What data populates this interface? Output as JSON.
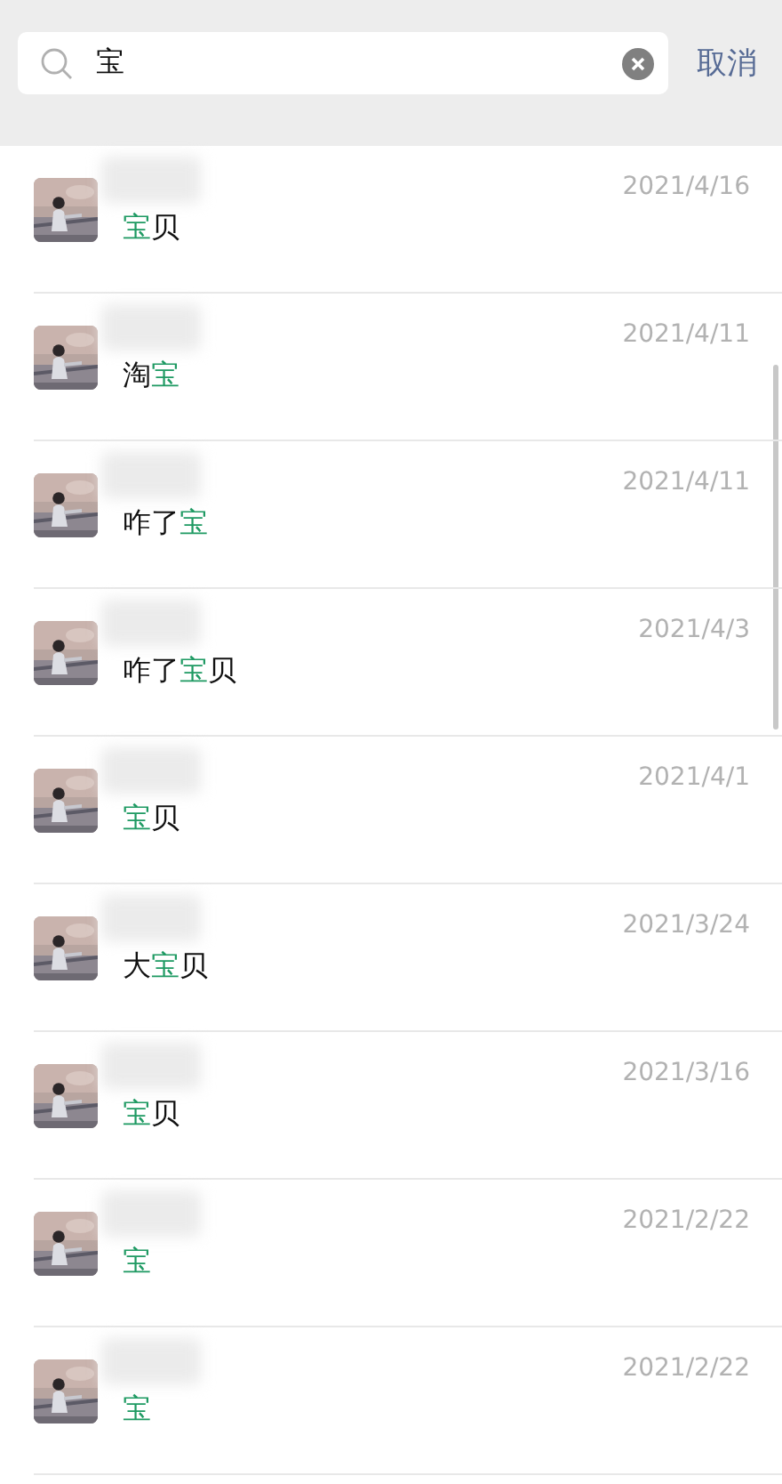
{
  "search": {
    "value": "宝",
    "cancel": "取消"
  },
  "results": [
    {
      "date": "2021/4/16",
      "message": [
        {
          "text": "宝",
          "match": true
        },
        {
          "text": "贝",
          "match": false
        }
      ]
    },
    {
      "date": "2021/4/11",
      "message": [
        {
          "text": "淘",
          "match": false
        },
        {
          "text": "宝",
          "match": true
        }
      ]
    },
    {
      "date": "2021/4/11",
      "message": [
        {
          "text": "咋了",
          "match": false
        },
        {
          "text": "宝",
          "match": true
        }
      ]
    },
    {
      "date": "2021/4/3",
      "message": [
        {
          "text": "咋了",
          "match": false
        },
        {
          "text": "宝",
          "match": true
        },
        {
          "text": "贝",
          "match": false
        }
      ]
    },
    {
      "date": "2021/4/1",
      "message": [
        {
          "text": "宝",
          "match": true
        },
        {
          "text": "贝",
          "match": false
        }
      ]
    },
    {
      "date": "2021/3/24",
      "message": [
        {
          "text": "大",
          "match": false
        },
        {
          "text": "宝",
          "match": true
        },
        {
          "text": "贝",
          "match": false
        }
      ]
    },
    {
      "date": "2021/3/16",
      "message": [
        {
          "text": "宝",
          "match": true
        },
        {
          "text": "贝",
          "match": false
        }
      ]
    },
    {
      "date": "2021/2/22",
      "message": [
        {
          "text": "宝",
          "match": true
        }
      ]
    },
    {
      "date": "2021/2/22",
      "message": [
        {
          "text": "宝",
          "match": true
        }
      ]
    }
  ]
}
